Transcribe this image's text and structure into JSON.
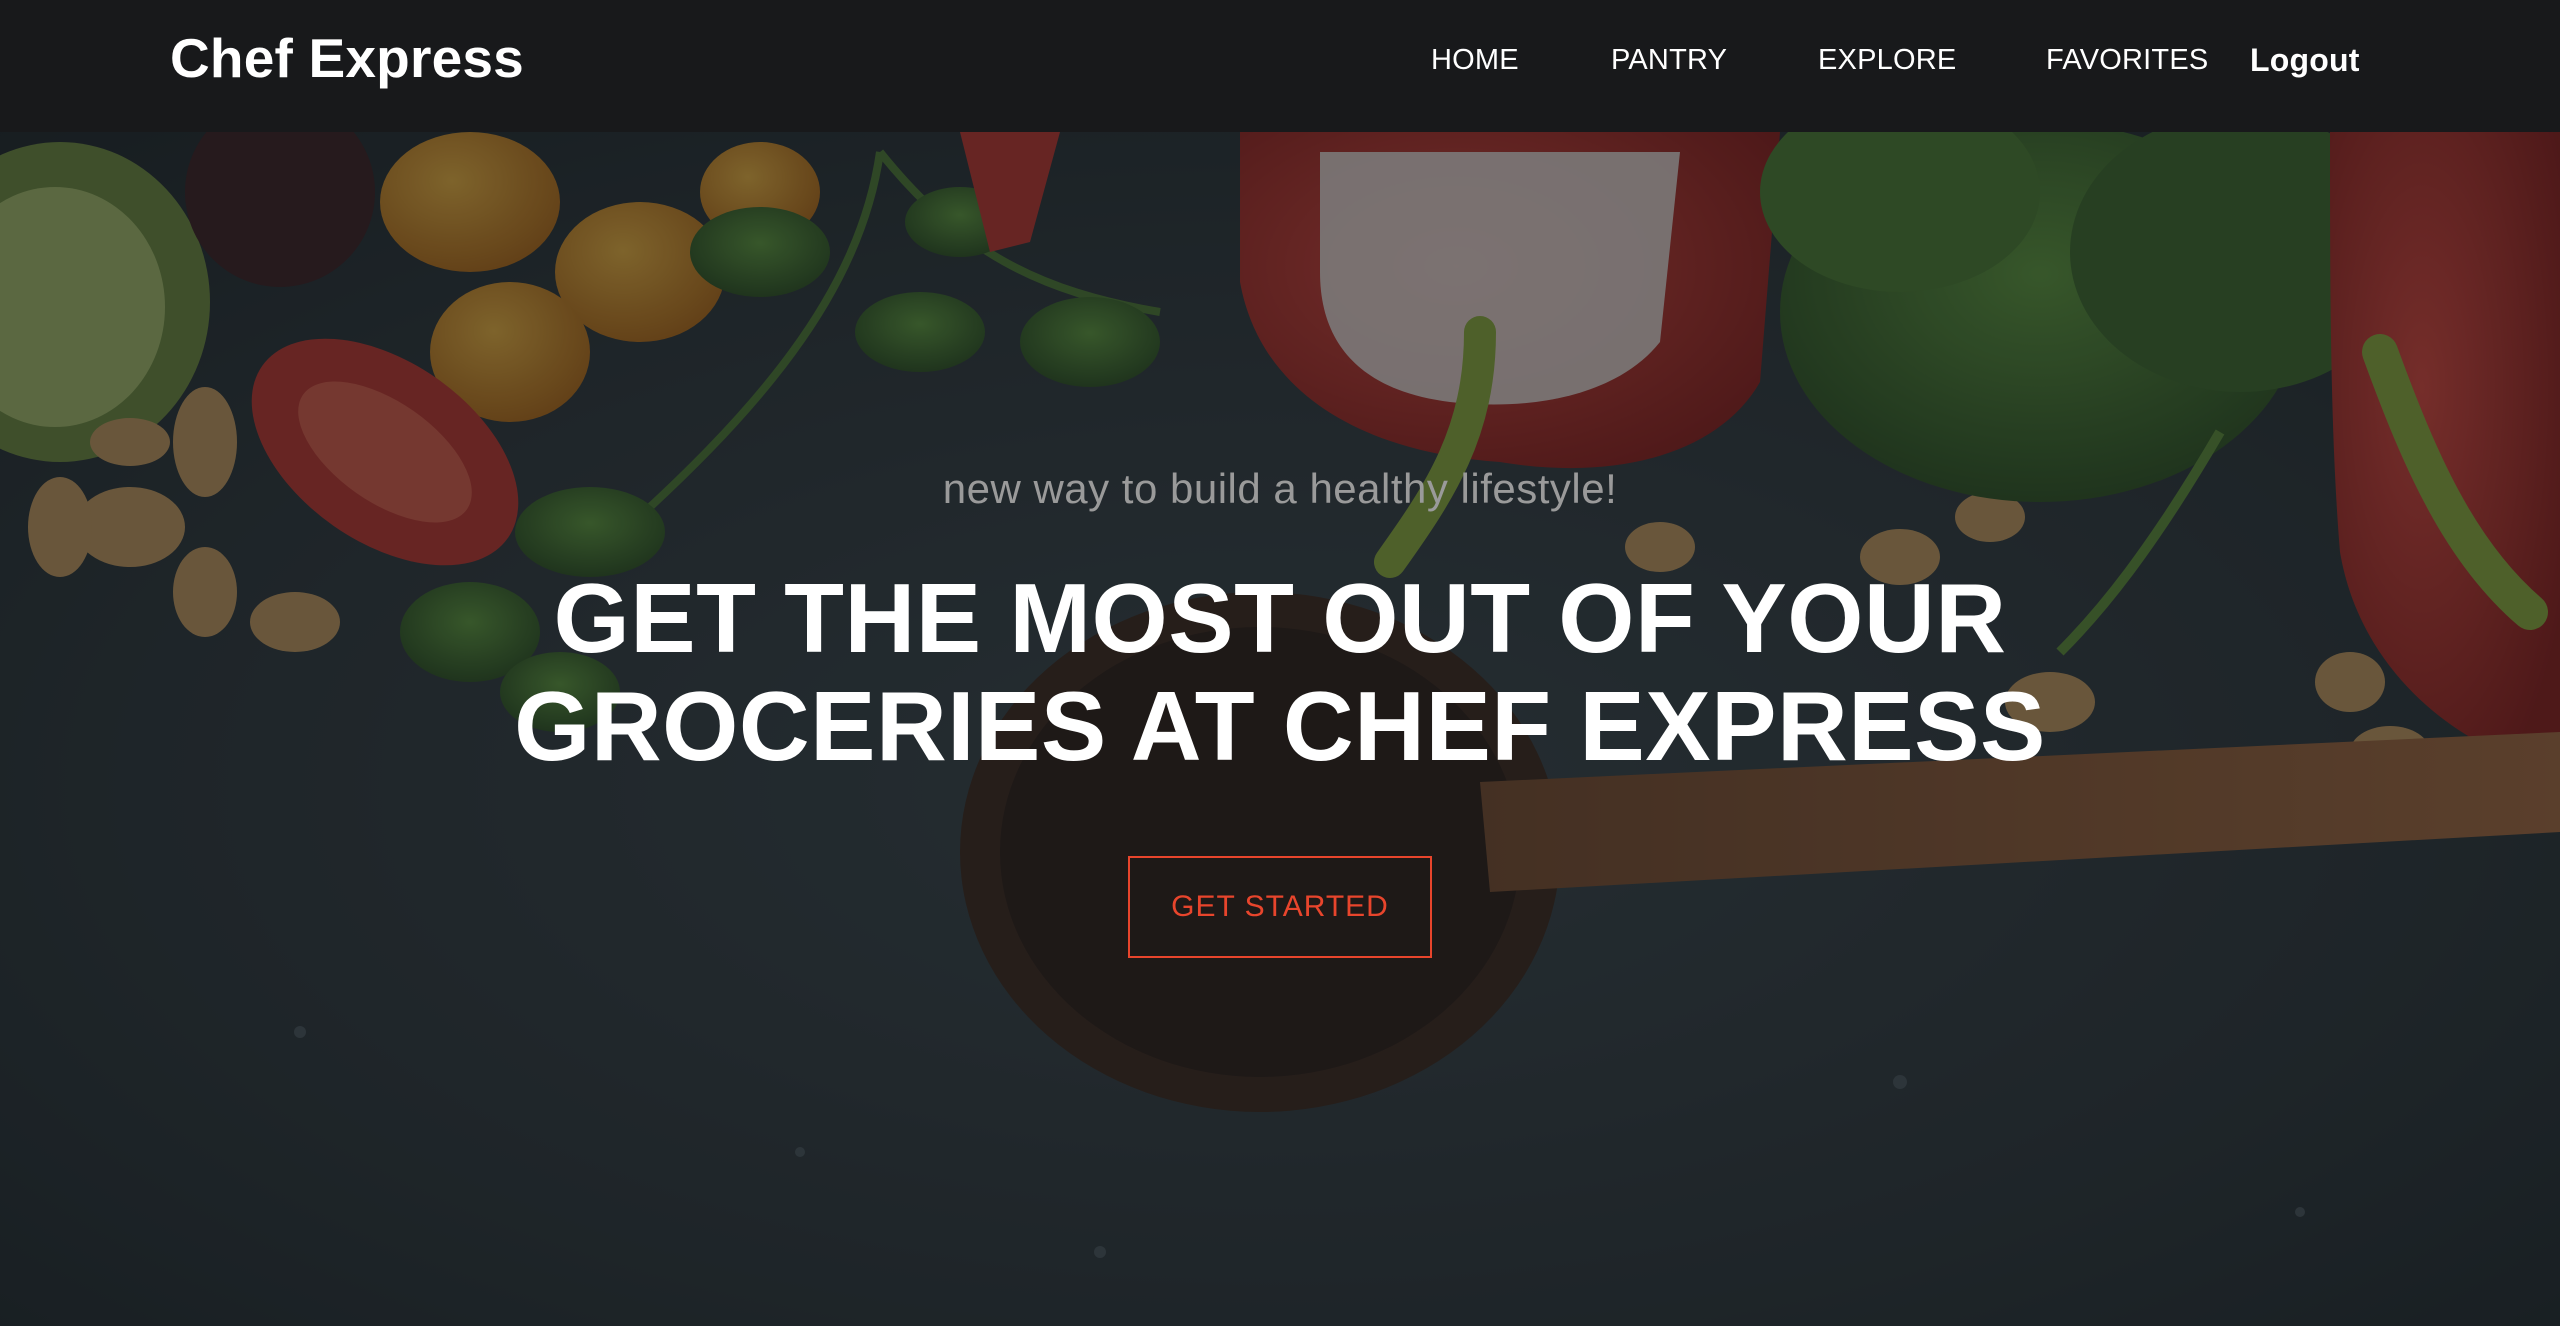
{
  "navbar": {
    "brand": "Chef Express",
    "links": [
      {
        "label": "HOME"
      },
      {
        "label": "PANTRY"
      },
      {
        "label": "EXPLORE"
      },
      {
        "label": "FAVORITES"
      }
    ],
    "logout": "Logout"
  },
  "hero": {
    "tagline": "new way to build a healthy lifestyle!",
    "headline": "GET THE MOST OUT OF YOUR GROCERIES AT CHEF EXPRESS",
    "cta_label": "GET STARTED"
  },
  "colors": {
    "navbar_bg": "#18191b",
    "accent": "#e8452c",
    "headline": "#ffffff",
    "tagline": "#9a9a9a"
  }
}
